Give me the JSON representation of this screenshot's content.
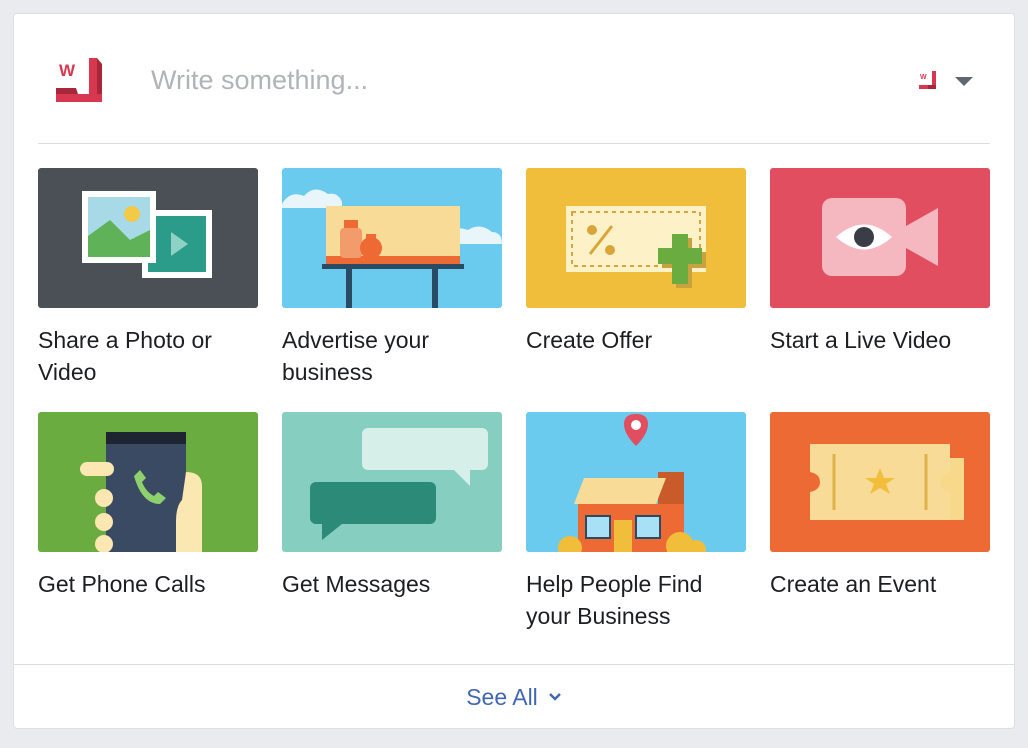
{
  "composer": {
    "placeholder": "Write something...",
    "logo_letter": "W",
    "brand_color": "#d8384f"
  },
  "actions": [
    {
      "label": "Share a Photo or Video",
      "icon": "photo-video-icon",
      "bg": "#4b4f56"
    },
    {
      "label": "Advertise your business",
      "icon": "billboard-icon",
      "bg": "#6bcbef"
    },
    {
      "label": "Create Offer",
      "icon": "offer-coupon-icon",
      "bg": "#f0be3a"
    },
    {
      "label": "Start a Live Video",
      "icon": "live-video-eye-icon",
      "bg": "#e04e5f"
    },
    {
      "label": "Get Phone Calls",
      "icon": "phone-hand-icon",
      "bg": "#6aac3f"
    },
    {
      "label": "Get Messages",
      "icon": "message-bubbles-icon",
      "bg": "#86cfc0"
    },
    {
      "label": "Help People Find your Business",
      "icon": "storefront-pin-icon",
      "bg": "#6bcbef"
    },
    {
      "label": "Create an Event",
      "icon": "event-ticket-icon",
      "bg": "#ee6a35"
    }
  ],
  "footer": {
    "see_all_label": "See All",
    "link_color": "#4267b2"
  }
}
